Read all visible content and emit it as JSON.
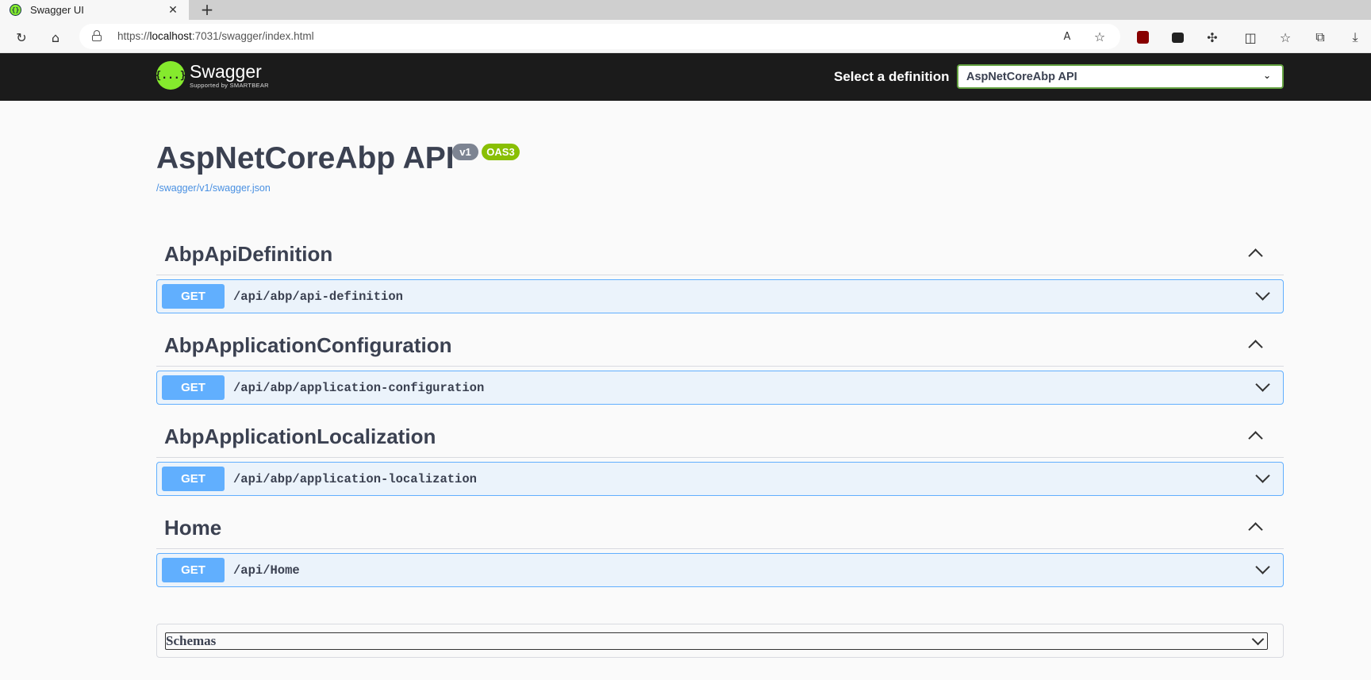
{
  "browser": {
    "tab_title": "Swagger UI",
    "tab_close": "✕",
    "new_tab": "+",
    "url_prefix": "https://",
    "url_host": "localhost",
    "url_rest": ":7031/swagger/index.html"
  },
  "header": {
    "logo_mark": "{...}",
    "logo_name": "Swagger",
    "logo_sub": "Supported by SMARTBEAR",
    "definition_label": "Select a definition",
    "definition_selected": "AspNetCoreAbp API"
  },
  "info": {
    "title": "AspNetCoreAbp API",
    "version": "v1",
    "oas": "OAS3",
    "spec_link": "/swagger/v1/swagger.json"
  },
  "tags": [
    {
      "name": "AbpApiDefinition",
      "operations": [
        {
          "method": "GET",
          "path": "/api/abp/api-definition"
        }
      ]
    },
    {
      "name": "AbpApplicationConfiguration",
      "operations": [
        {
          "method": "GET",
          "path": "/api/abp/application-configuration"
        }
      ]
    },
    {
      "name": "AbpApplicationLocalization",
      "operations": [
        {
          "method": "GET",
          "path": "/api/abp/application-localization"
        }
      ]
    },
    {
      "name": "Home",
      "operations": [
        {
          "method": "GET",
          "path": "/api/Home"
        }
      ]
    }
  ],
  "schemas": {
    "label": "Schemas"
  },
  "colors": {
    "get": "#61affe",
    "get_bg": "#ebf3fb",
    "topbar": "#1b1b1b",
    "brand": "#85ea2d"
  }
}
